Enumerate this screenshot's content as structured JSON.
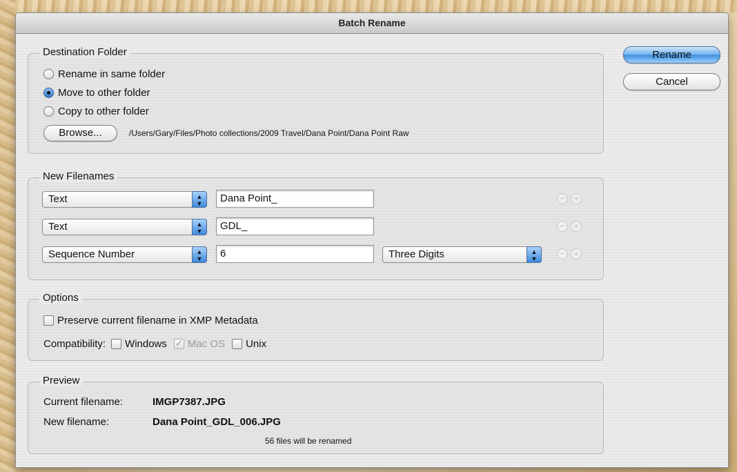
{
  "window": {
    "title": "Batch Rename"
  },
  "buttons": {
    "rename": "Rename",
    "cancel": "Cancel",
    "browse": "Browse..."
  },
  "destination": {
    "title": "Destination Folder",
    "options": [
      {
        "label": "Rename in same folder",
        "selected": false
      },
      {
        "label": "Move to other folder",
        "selected": true
      },
      {
        "label": "Copy to other folder",
        "selected": false
      }
    ],
    "path": "/Users/Gary/Files/Photo collections/2009 Travel/Dana Point/Dana Point Raw"
  },
  "new_filenames": {
    "title": "New Filenames",
    "rows": [
      {
        "type": "Text",
        "value": "Dana Point_"
      },
      {
        "type": "Text",
        "value": "GDL_"
      },
      {
        "type": "Sequence Number",
        "value": "6",
        "digits": "Three Digits"
      }
    ],
    "icons": {
      "remove": "minus-circle-icon",
      "add": "plus-circle-icon"
    }
  },
  "options": {
    "title": "Options",
    "preserve_label": "Preserve current filename in XMP Metadata",
    "preserve_checked": false,
    "compat_label": "Compatibility:",
    "compat": [
      {
        "label": "Windows",
        "checked": false,
        "disabled": false
      },
      {
        "label": "Mac OS",
        "checked": true,
        "disabled": true
      },
      {
        "label": "Unix",
        "checked": false,
        "disabled": false
      }
    ]
  },
  "preview": {
    "title": "Preview",
    "current_label": "Current filename:",
    "current_value": "IMGP7387.JPG",
    "new_label": "New filename:",
    "new_value": "Dana Point_GDL_006.JPG",
    "count_text": "56 files will be renamed"
  },
  "colors": {
    "accent": "#3b8ee0",
    "window_bg": "#e9e9e9"
  }
}
